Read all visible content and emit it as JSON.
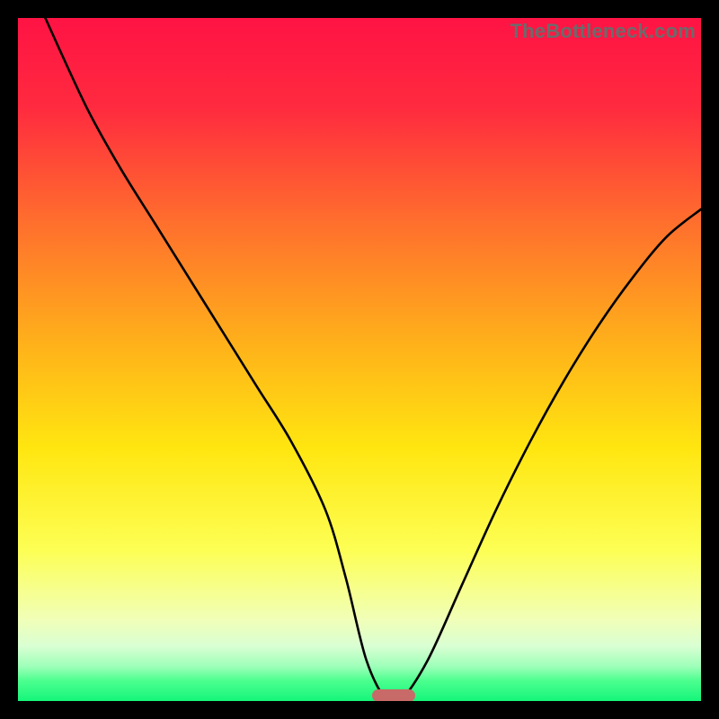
{
  "watermark": {
    "text": "TheBottleneck.com"
  },
  "colors": {
    "frame": "#000000",
    "gradient_stops": [
      {
        "pct": 0,
        "color": "#ff1344"
      },
      {
        "pct": 13,
        "color": "#ff2a3f"
      },
      {
        "pct": 30,
        "color": "#ff6f2d"
      },
      {
        "pct": 48,
        "color": "#ffb21a"
      },
      {
        "pct": 63,
        "color": "#ffe610"
      },
      {
        "pct": 78,
        "color": "#fdff55"
      },
      {
        "pct": 88,
        "color": "#f1ffb7"
      },
      {
        "pct": 92,
        "color": "#d9ffd3"
      },
      {
        "pct": 95,
        "color": "#9cffb8"
      },
      {
        "pct": 97,
        "color": "#4dff8f"
      },
      {
        "pct": 100,
        "color": "#14f57a"
      }
    ],
    "curve_stroke": "#000000",
    "marker_fill": "#c86a68"
  },
  "chart_data": {
    "type": "line",
    "title": "",
    "xlabel": "",
    "ylabel": "",
    "xlim": [
      0,
      100
    ],
    "ylim": [
      0,
      100
    ],
    "grid": false,
    "series": [
      {
        "name": "bottleneck-curve",
        "x": [
          4,
          10,
          15,
          20,
          25,
          30,
          35,
          40,
          45,
          48,
          51,
          54,
          56,
          60,
          65,
          70,
          75,
          80,
          85,
          90,
          95,
          100
        ],
        "y": [
          100,
          87,
          78,
          70,
          62,
          54,
          46,
          38,
          28,
          18,
          6,
          0,
          0,
          6,
          17,
          28,
          38,
          47,
          55,
          62,
          68,
          72
        ]
      }
    ],
    "annotations": [
      {
        "name": "optimal-marker",
        "x": 55,
        "y": 0,
        "shape": "pill"
      }
    ]
  }
}
